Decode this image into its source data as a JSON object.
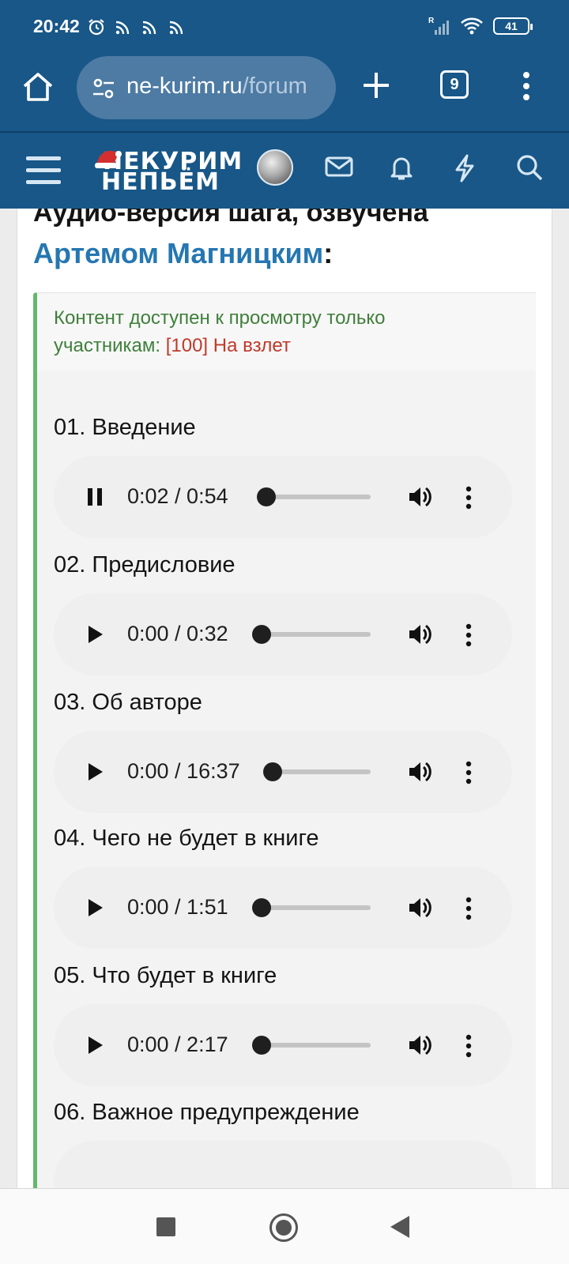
{
  "status_bar": {
    "time": "20:42",
    "battery": "41",
    "left_icons": [
      "alarm-icon",
      "cast-icon",
      "cast-icon",
      "cast-icon"
    ],
    "right_icons": [
      "signal-icon",
      "wifi-icon",
      "battery-icon"
    ]
  },
  "browser": {
    "url_domain": "ne-kurim.ru",
    "url_path": "/forum",
    "tabs_count": "9"
  },
  "site": {
    "logo_line1": "НЕКУРИМ",
    "logo_line2": "НЕПЬЁМ",
    "brand_color": "#185787"
  },
  "content": {
    "title_partial": "Аудио-версия шага, озвучена",
    "title_author": "Артемом Магницким",
    "title_colon": ":",
    "notice_prefix": "Контент доступен к просмотру только участникам: ",
    "notice_group": "[100] На взлет",
    "tracks": [
      {
        "title": "01. Введение",
        "time": "0:02 / 0:54",
        "state": "pause",
        "progress": 0.04
      },
      {
        "title": "02. Предисловие",
        "time": "0:00 / 0:32",
        "state": "play",
        "progress": 0
      },
      {
        "title": "03. Об авторе",
        "time": "0:00 / 16:37",
        "state": "play",
        "progress": 0
      },
      {
        "title": "04. Чего не будет в книге",
        "time": "0:00 / 1:51",
        "state": "play",
        "progress": 0
      },
      {
        "title": "05. Что будет в книге",
        "time": "0:00 / 2:17",
        "state": "play",
        "progress": 0
      },
      {
        "title": "06. Важное предупреждение"
      }
    ]
  }
}
